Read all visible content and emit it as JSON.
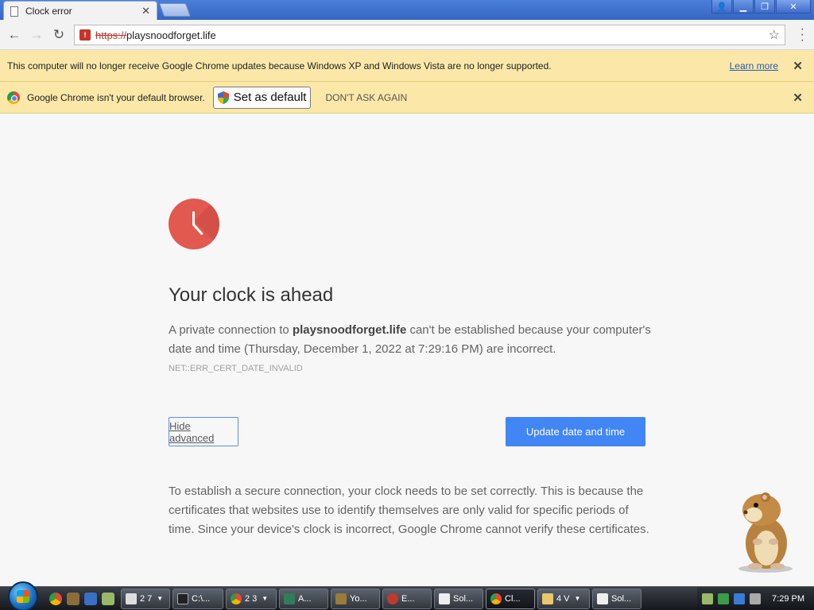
{
  "tab": {
    "title": "Clock error"
  },
  "omnibox": {
    "scheme": "https://",
    "host": "playsnoodforget.life"
  },
  "infobar_updates": {
    "message": "This computer will no longer receive Google Chrome updates because Windows XP and Windows Vista are no longer supported.",
    "link": "Learn more"
  },
  "infobar_default": {
    "message": "Google Chrome isn't your default browser.",
    "set_default": "Set as default",
    "dont_ask": "DON'T ASK AGAIN"
  },
  "error": {
    "title": "Your clock is ahead",
    "desc_prefix": "A private connection to ",
    "desc_host": "playsnoodforget.life",
    "desc_suffix": " can't be established because your computer's date and time (Thursday, December 1, 2022 at 7:29:16 PM) are incorrect.",
    "code": "NET::ERR_CERT_DATE_INVALID",
    "hide_advanced": "Hide advanced",
    "update_button": "Update date and time",
    "details": "To establish a secure connection, your clock needs to be set correctly. This is because the certificates that websites use to identify themselves are only valid for specific periods of time. Since your device's clock is incorrect, Google Chrome cannot verify these certificates."
  },
  "taskbar": {
    "tasks": [
      {
        "label": "2 7",
        "icon": "window-group-icon"
      },
      {
        "label": "C:\\...",
        "icon": "cmd-icon"
      },
      {
        "label": "2 3",
        "icon": "chrome-icon"
      },
      {
        "label": "A...",
        "icon": "app-icon"
      },
      {
        "label": "Yo...",
        "icon": "app-icon"
      },
      {
        "label": "E...",
        "icon": "app-icon"
      },
      {
        "label": "Sol...",
        "icon": "solitaire-icon"
      },
      {
        "label": "Cl...",
        "icon": "chrome-icon"
      },
      {
        "label": "4 V",
        "icon": "folder-icon"
      },
      {
        "label": "Sol...",
        "icon": "solitaire-icon"
      }
    ],
    "clock": "7:29 PM"
  },
  "colors": {
    "accent": "#4285f4",
    "infobar": "#fbe8a8",
    "clock_red": "#e25950"
  }
}
